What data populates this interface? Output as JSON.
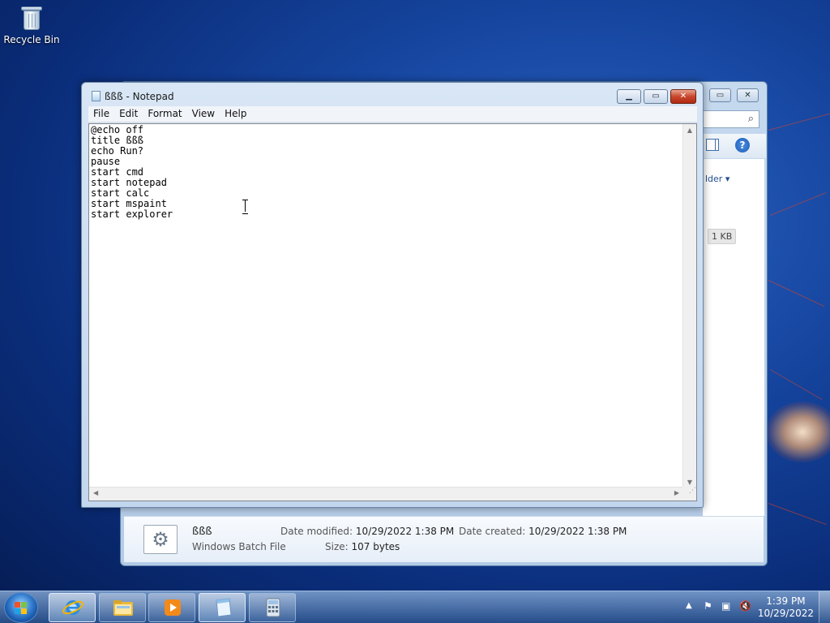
{
  "desktop": {
    "recycle_bin_label": "Recycle Bin"
  },
  "explorer": {
    "button_label": "lder",
    "file_size_cell": "1 KB",
    "details": {
      "file_name": "ßßß",
      "file_type": "Windows Batch File",
      "date_modified_label": "Date modified:",
      "date_modified_value": "10/29/2022 1:38 PM",
      "date_created_label": "Date created:",
      "date_created_value": "10/29/2022 1:38 PM",
      "size_label": "Size:",
      "size_value": "107 bytes"
    }
  },
  "notepad": {
    "title": "ßßß - Notepad",
    "menu": [
      "File",
      "Edit",
      "Format",
      "View",
      "Help"
    ],
    "content": "@echo off\ntitle ßßß\necho Run?\npause\nstart cmd\nstart notepad\nstart calc\nstart mspaint\nstart explorer"
  },
  "taskbar": {
    "pinned": [
      {
        "name": "Internet Explorer",
        "icon": "ie-icon",
        "active": true
      },
      {
        "name": "Windows Explorer",
        "icon": "folder-icon",
        "active": false
      },
      {
        "name": "Windows Media Player",
        "icon": "media-player-icon",
        "active": false
      },
      {
        "name": "Notepad",
        "icon": "notepad-icon",
        "active": true
      },
      {
        "name": "Calculator",
        "icon": "calculator-icon",
        "active": false
      }
    ],
    "time": "1:39 PM",
    "date": "10/29/2022"
  },
  "colors": {
    "close_button": "#c8472c",
    "desktop_bg": "#1646a0"
  }
}
